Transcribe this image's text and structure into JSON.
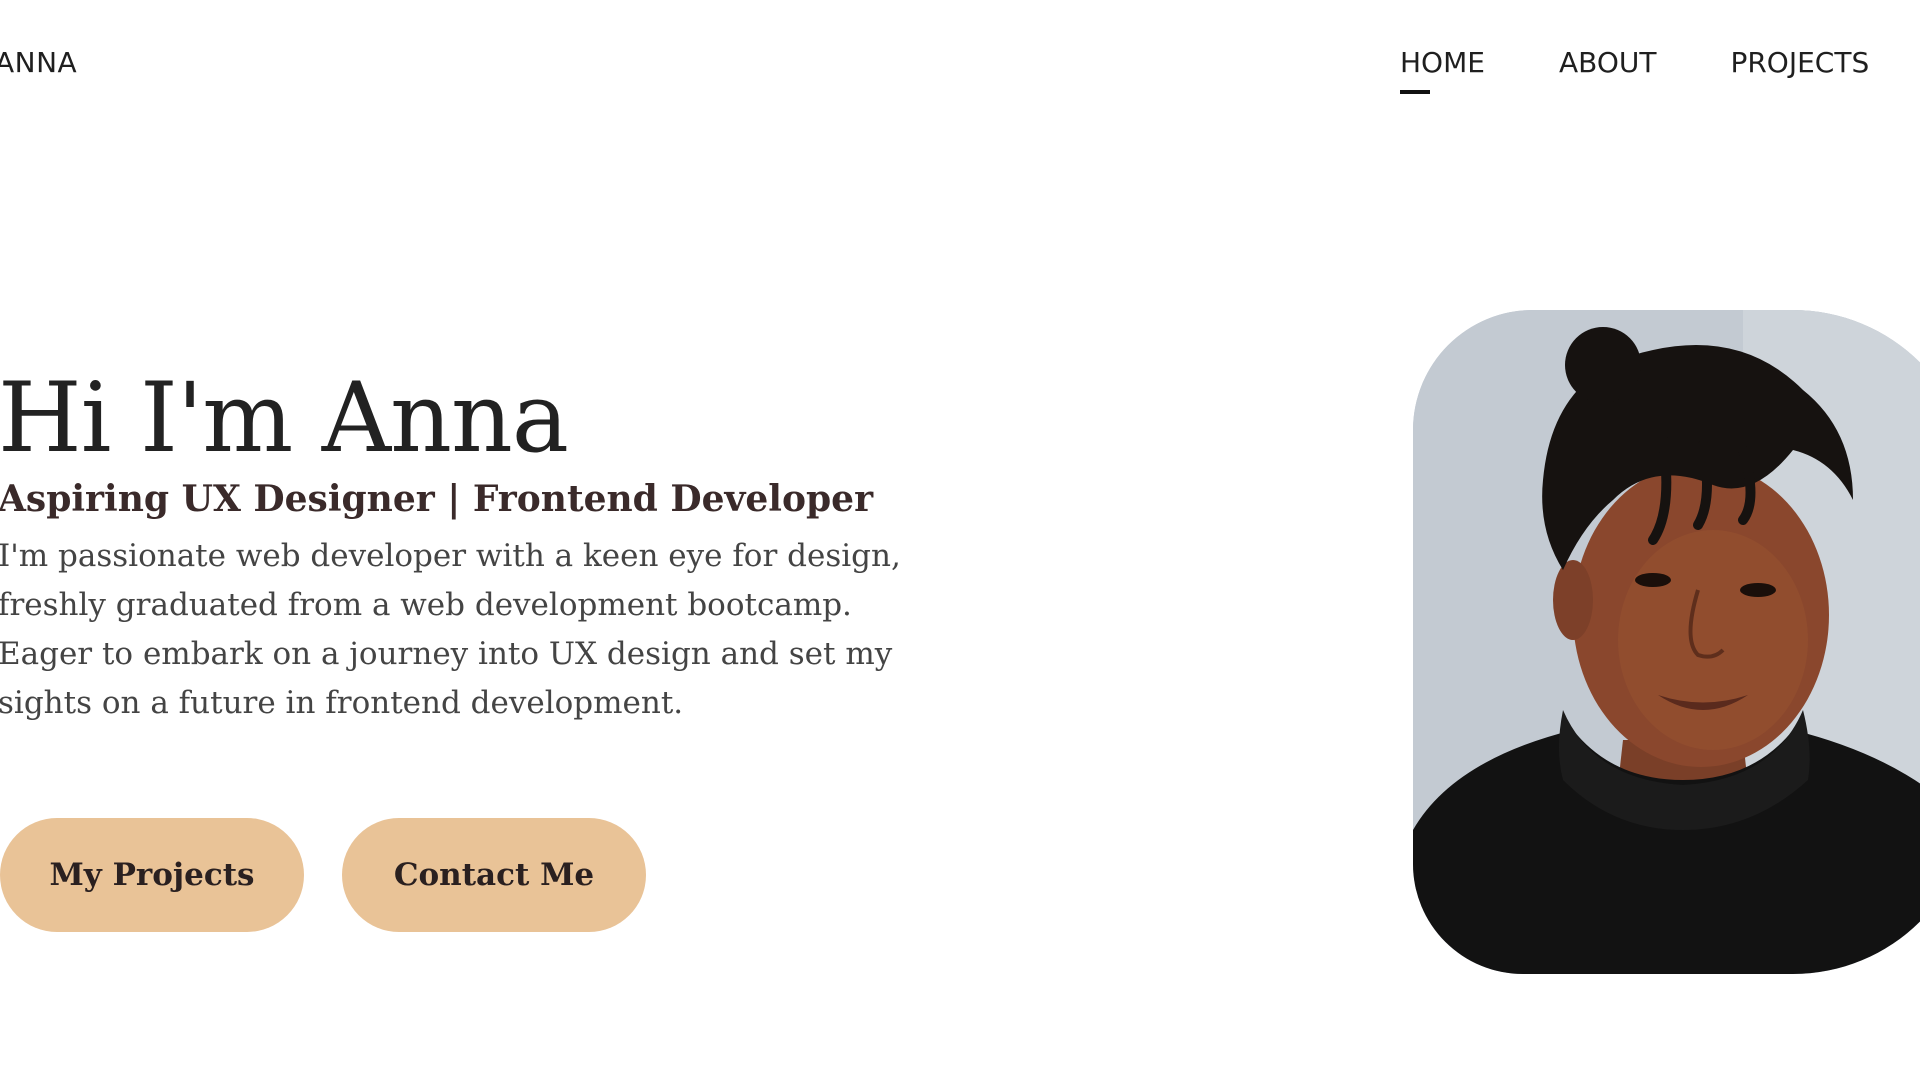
{
  "header": {
    "logo": "ANNA",
    "nav": [
      {
        "label": "HOME",
        "active": true
      },
      {
        "label": "ABOUT",
        "active": false
      },
      {
        "label": "PROJECTS",
        "active": false
      }
    ]
  },
  "hero": {
    "title": "Hi I'm Anna",
    "subtitle": "Aspiring UX Designer | Frontend Developer",
    "description": "I'm passionate web developer with a keen eye for design, freshly graduated from a web development bootcamp. Eager to embark on a journey into UX design and set my sights on a future in frontend development.",
    "buttons": {
      "projects": "My Projects",
      "contact": "Contact Me"
    }
  },
  "colors": {
    "button_bg": "#e9c397",
    "text_dark": "#222222",
    "nav_underline": "#111111"
  }
}
